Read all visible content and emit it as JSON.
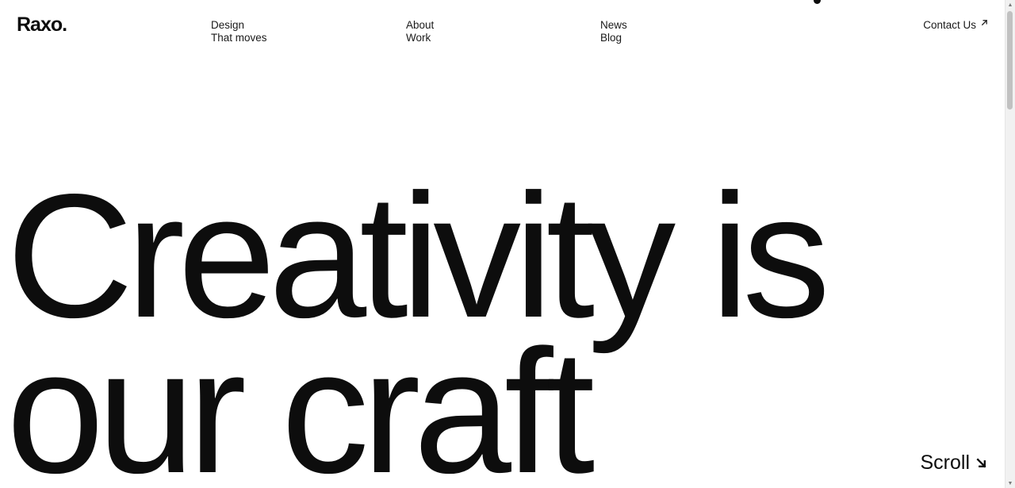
{
  "brand": {
    "logo": "Raxo."
  },
  "nav": {
    "groups": [
      {
        "line1": "Design",
        "line2": "That moves"
      },
      {
        "line1": "About",
        "line2": "Work"
      },
      {
        "line1": "News",
        "line2": "Blog"
      }
    ],
    "contact_label": "Contact Us",
    "contact_icon": "arrow-up-right-icon"
  },
  "hero": {
    "line1": "Creativity is",
    "line2": "our craft"
  },
  "scroll": {
    "label": "Scroll",
    "icon": "arrow-down-right-icon"
  },
  "colors": {
    "background": "#ffffff",
    "text": "#0d0d0d"
  }
}
